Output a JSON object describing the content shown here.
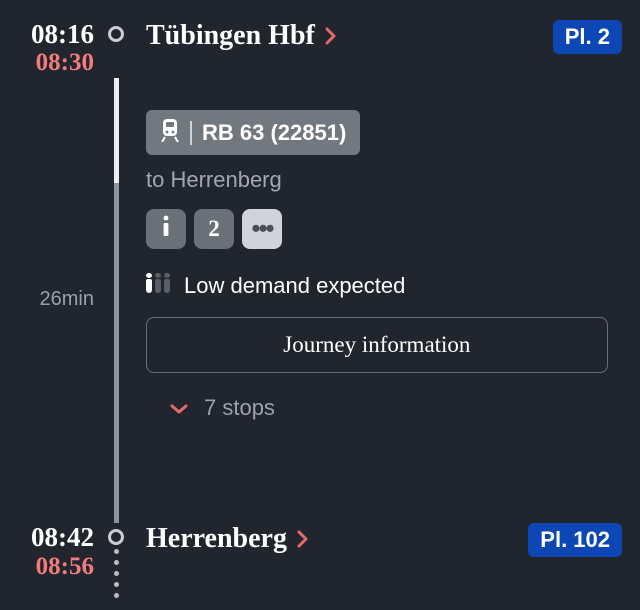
{
  "departure": {
    "scheduled": "08:16",
    "realtime": "08:30",
    "station": "Tübingen Hbf",
    "platform_label": "Pl. 2"
  },
  "arrival": {
    "scheduled": "08:42",
    "realtime": "08:56",
    "station": "Herrenberg",
    "platform_label": "Pl. 102"
  },
  "segment": {
    "duration_label": "26min",
    "train_label": "RB 63 (22851)",
    "destination_prefix": "to ",
    "destination": "Herrenberg",
    "class_label": "2",
    "demand_label": "Low demand expected",
    "journey_button": "Journey information",
    "stops_label": "7 stops"
  }
}
